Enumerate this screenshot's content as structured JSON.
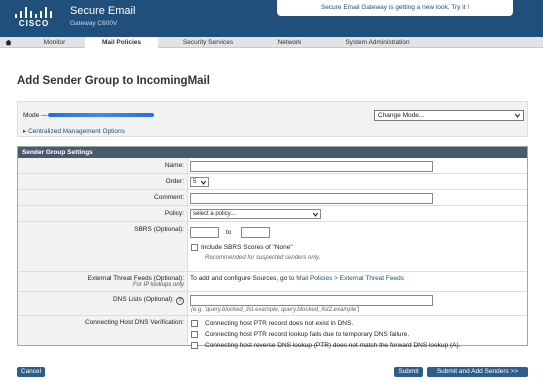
{
  "header": {
    "brand": "CISCO",
    "product": "Secure Email",
    "model": "Gateway C600V",
    "banner": "Secure Email Gateway is getting a new look. Try it !"
  },
  "nav": {
    "tabs": [
      "Monitor",
      "Mail Policies",
      "Security Services",
      "Network",
      "System Administration"
    ],
    "active": "Mail Policies"
  },
  "page": {
    "title": "Add Sender Group to IncomingMail"
  },
  "mode": {
    "label": "Mode —",
    "centralized_link": "Centralized Management Options",
    "change_mode": "Change Mode..."
  },
  "settings": {
    "section_title": "Sender Group Settings",
    "name_label": "Name:",
    "name_value": "",
    "order_label": "Order:",
    "order_value": "5",
    "comment_label": "Comment:",
    "comment_value": "",
    "policy_label": "Policy:",
    "policy_value": "select a policy...",
    "sbrs_label": "SBRS (Optional):",
    "sbrs_to": "to",
    "sbrs_include": "Include SBRS Scores of \"None\"",
    "sbrs_note": "Recommended for suspected senders only.",
    "etf_label": "External Threat Feeds (Optional):",
    "etf_sublabel": "For IP lookups only",
    "etf_text": "To add and configure Sources, go to",
    "etf_link": "Mail Policies > External Threat Feeds",
    "dns_label": "DNS Lists (Optional):",
    "dns_help": "?",
    "dns_placeholder": "(e.g. 'query.blocked_list.example, query.blocked_list2.example')",
    "chdv_label": "Connecting Host DNS Verification:",
    "chdv_options": [
      "Connecting host PTR record does not exist in DNS.",
      "Connecting host PTR record lookup fails due to temporary DNS failure.",
      "Connecting host reverse DNS lookup (PTR) does not match the forward DNS lookup (A)."
    ]
  },
  "buttons": {
    "cancel": "Cancel",
    "submit": "Submit",
    "submit_add": "Submit and Add Senders >>"
  }
}
